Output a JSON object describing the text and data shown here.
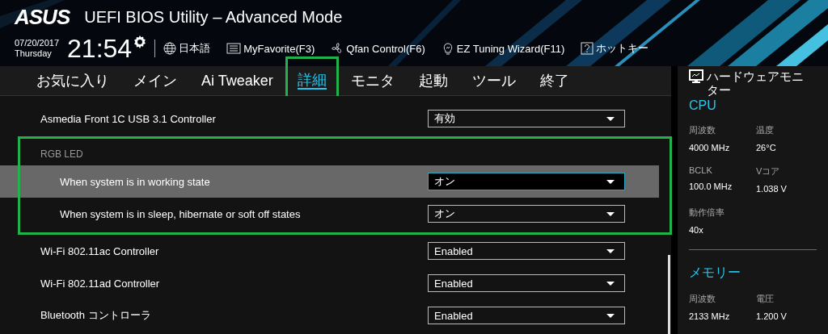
{
  "header": {
    "logo": "ASUS",
    "title": "UEFI BIOS Utility – Advanced Mode",
    "date": "07/20/2017",
    "day": "Thursday",
    "time": "21:54",
    "shortcuts": [
      {
        "kind": "language",
        "label": "日本語"
      },
      {
        "kind": "favorite",
        "label": "MyFavorite(F3)"
      },
      {
        "kind": "fan",
        "label": "Qfan Control(F6)"
      },
      {
        "kind": "wizard",
        "label": "EZ Tuning Wizard(F11)"
      },
      {
        "kind": "hotkey",
        "label": "ホットキー"
      }
    ]
  },
  "tabs": [
    {
      "label": "お気に入り",
      "selected": false,
      "highlighted": false
    },
    {
      "label": "メイン",
      "selected": false,
      "highlighted": false
    },
    {
      "label": "Ai Tweaker",
      "selected": false,
      "highlighted": false
    },
    {
      "label": "詳細",
      "selected": true,
      "highlighted": true
    },
    {
      "label": "モニタ",
      "selected": false,
      "highlighted": false
    },
    {
      "label": "起動",
      "selected": false,
      "highlighted": false
    },
    {
      "label": "ツール",
      "selected": false,
      "highlighted": false
    },
    {
      "label": "終了",
      "selected": false,
      "highlighted": false
    }
  ],
  "settings": [
    {
      "kind": "item",
      "label": "Asmedia Front 1C USB 3.1 Controller",
      "value": "有効",
      "selected": false
    },
    {
      "kind": "group",
      "label": "RGB LED",
      "highlighted": true,
      "children": [
        {
          "kind": "item",
          "label": "When system is in working state",
          "value": "オン",
          "selected": true
        },
        {
          "kind": "item",
          "label": "When system is in sleep, hibernate or soft off states",
          "value": "オン",
          "selected": false
        }
      ]
    },
    {
      "kind": "item",
      "label": "Wi-Fi 802.11ac Controller",
      "value": "Enabled",
      "selected": false
    },
    {
      "kind": "item",
      "label": "Wi-Fi 802.11ad Controller",
      "value": "Enabled",
      "selected": false
    },
    {
      "kind": "item",
      "label": "Bluetooth コントローラ",
      "value": "Enabled",
      "selected": false
    }
  ],
  "hardware_monitor": {
    "title": "ハードウェアモニター",
    "sections": [
      {
        "title": "CPU",
        "fields": [
          {
            "label": "周波数",
            "value": "4000 MHz"
          },
          {
            "label": "温度",
            "value": "26°C"
          },
          {
            "label": "BCLK",
            "value": "100.0 MHz"
          },
          {
            "label": "Vコア",
            "value": "1.038 V"
          },
          {
            "label": "動作倍率",
            "value": "40x"
          }
        ]
      },
      {
        "title": "メモリー",
        "fields": [
          {
            "label": "周波数",
            "value": "2133 MHz"
          },
          {
            "label": "電圧",
            "value": "1.200 V"
          }
        ]
      }
    ]
  }
}
